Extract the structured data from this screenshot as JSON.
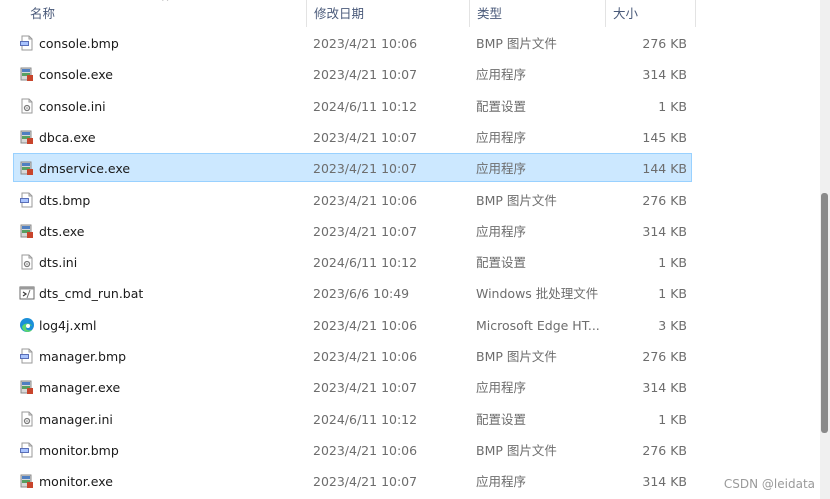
{
  "columns": {
    "name": "名称",
    "date": "修改日期",
    "type": "类型",
    "size": "大小"
  },
  "files": [
    {
      "name": "console.bmp",
      "date": "2023/4/21 10:06",
      "type": "BMP 图片文件",
      "size": "276 KB",
      "icon": "bmp-file-icon"
    },
    {
      "name": "console.exe",
      "date": "2023/4/21 10:07",
      "type": "应用程序",
      "size": "314 KB",
      "icon": "exe-file-icon"
    },
    {
      "name": "console.ini",
      "date": "2024/6/11 10:12",
      "type": "配置设置",
      "size": "1 KB",
      "icon": "ini-file-icon"
    },
    {
      "name": "dbca.exe",
      "date": "2023/4/21 10:07",
      "type": "应用程序",
      "size": "145 KB",
      "icon": "exe-file-icon"
    },
    {
      "name": "dmservice.exe",
      "date": "2023/4/21 10:07",
      "type": "应用程序",
      "size": "144 KB",
      "icon": "exe-file-icon",
      "selected": true
    },
    {
      "name": "dts.bmp",
      "date": "2023/4/21 10:06",
      "type": "BMP 图片文件",
      "size": "276 KB",
      "icon": "bmp-file-icon"
    },
    {
      "name": "dts.exe",
      "date": "2023/4/21 10:07",
      "type": "应用程序",
      "size": "314 KB",
      "icon": "exe-file-icon"
    },
    {
      "name": "dts.ini",
      "date": "2024/6/11 10:12",
      "type": "配置设置",
      "size": "1 KB",
      "icon": "ini-file-icon"
    },
    {
      "name": "dts_cmd_run.bat",
      "date": "2023/6/6 10:49",
      "type": "Windows 批处理文件",
      "size": "1 KB",
      "icon": "bat-file-icon"
    },
    {
      "name": "log4j.xml",
      "date": "2023/4/21 10:06",
      "type": "Microsoft Edge HT...",
      "size": "3 KB",
      "icon": "edge-file-icon"
    },
    {
      "name": "manager.bmp",
      "date": "2023/4/21 10:06",
      "type": "BMP 图片文件",
      "size": "276 KB",
      "icon": "bmp-file-icon"
    },
    {
      "name": "manager.exe",
      "date": "2023/4/21 10:07",
      "type": "应用程序",
      "size": "314 KB",
      "icon": "exe-file-icon"
    },
    {
      "name": "manager.ini",
      "date": "2024/6/11 10:12",
      "type": "配置设置",
      "size": "1 KB",
      "icon": "ini-file-icon"
    },
    {
      "name": "monitor.bmp",
      "date": "2023/4/21 10:06",
      "type": "BMP 图片文件",
      "size": "276 KB",
      "icon": "bmp-file-icon"
    },
    {
      "name": "monitor.exe",
      "date": "2023/4/21 10:07",
      "type": "应用程序",
      "size": "314 KB",
      "icon": "exe-file-icon"
    }
  ],
  "watermark": "CSDN @leidata",
  "colors": {
    "selection_bg": "#cce8ff",
    "selection_border": "#99d1ff",
    "header_text": "#4a5a7a",
    "secondary_text": "#6d6d6d"
  }
}
